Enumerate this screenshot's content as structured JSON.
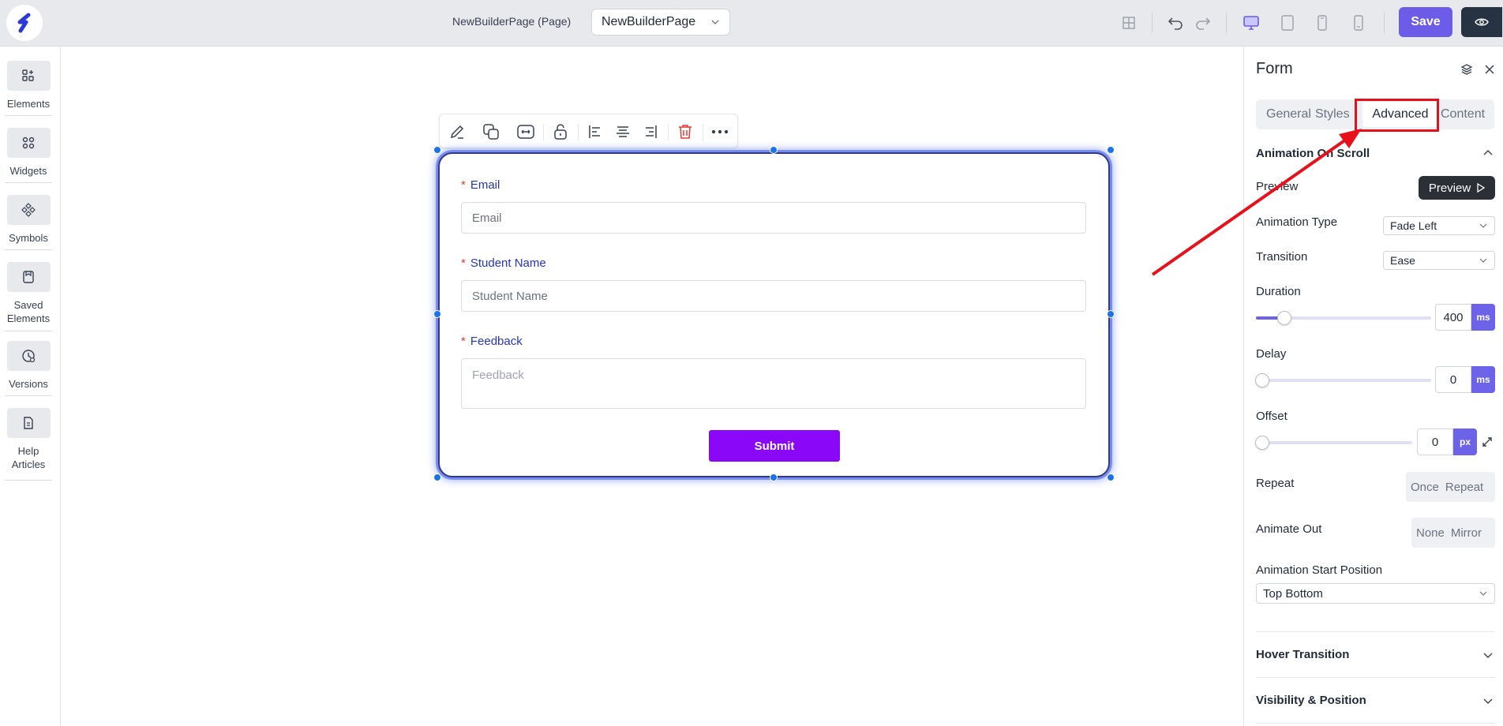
{
  "topbar": {
    "page_label": "NewBuilderPage (Page)",
    "page_select": "NewBuilderPage",
    "save_label": "Save"
  },
  "sidebar": {
    "items": [
      {
        "label": "Elements",
        "icon": "elements-icon"
      },
      {
        "label": "Widgets",
        "icon": "widgets-icon"
      },
      {
        "label": "Symbols",
        "icon": "symbols-icon"
      },
      {
        "label": "Saved Elements",
        "icon": "saved-elements-icon"
      },
      {
        "label": "Versions",
        "icon": "versions-icon"
      },
      {
        "label": "Help Articles",
        "icon": "help-articles-icon"
      }
    ]
  },
  "form": {
    "email_label": "Email",
    "email_placeholder": "Email",
    "student_label": "Student Name",
    "student_placeholder": "Student Name",
    "feedback_label": "Feedback",
    "feedback_placeholder": "Feedback",
    "submit_label": "Submit",
    "required_mark": "*"
  },
  "panel": {
    "title": "Form",
    "tabs": [
      "General",
      "Styles",
      "Advanced",
      "Content"
    ],
    "active_tab": "Advanced",
    "animation_section": "Animation On Scroll",
    "preview_label": "Preview",
    "preview_button": "Preview",
    "animation_type_label": "Animation Type",
    "animation_type_value": "Fade Left",
    "transition_label": "Transition",
    "transition_value": "Ease",
    "duration_label": "Duration",
    "duration_value": "400",
    "duration_unit": "ms",
    "duration_fraction": 0.16,
    "delay_label": "Delay",
    "delay_value": "0",
    "delay_unit": "ms",
    "offset_label": "Offset",
    "offset_value": "0",
    "offset_unit": "px",
    "repeat_label": "Repeat",
    "repeat_options": [
      "Once",
      "Repeat"
    ],
    "animate_out_label": "Animate Out",
    "animate_out_options": [
      "None",
      "Mirror"
    ],
    "start_position_label": "Animation Start Position",
    "start_position_value": "Top Bottom",
    "hover_section": "Hover Transition",
    "visibility_section": "Visibility & Position"
  },
  "colors": {
    "accent": "#6c5ce7",
    "submit": "#8b07f7",
    "annotation": "#e8101a",
    "label_blue": "#2434c6"
  }
}
